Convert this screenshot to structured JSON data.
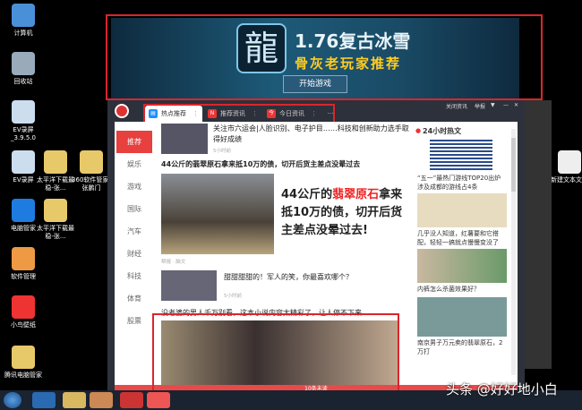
{
  "desktop": {
    "icons": [
      {
        "label": "计算机",
        "color": "#4a90d9"
      },
      {
        "label": "回收站",
        "color": "#9ab"
      },
      {
        "label": "EV录屏_3.9.5.0",
        "color": "#cde"
      },
      {
        "label": "EV录屏",
        "color": "#cde"
      },
      {
        "label": "太平洋下载最稳-张...",
        "color": "#e8c96a"
      },
      {
        "label": "360软件管家-张鹏门",
        "color": "#e8c96a"
      },
      {
        "label": "电脑管家",
        "color": "#1e7be0"
      },
      {
        "label": "太平洋下载最稳-张...",
        "color": "#e8c96a"
      },
      {
        "label": "软件管理",
        "color": "#e94"
      },
      {
        "label": "小鸟壁纸",
        "color": "#e33"
      },
      {
        "label": "腾讯电脑管家",
        "color": "#e8c96a"
      },
      {
        "label": "新建文本文档",
        "color": "#eee"
      }
    ]
  },
  "banner": {
    "logo": "龍",
    "title": "1.76复古冰雪",
    "subtitle": "骨灰老玩家推荐",
    "button": "开始游戏"
  },
  "window": {
    "tabs": [
      {
        "label": "热点推荐",
        "icon": "news-icon",
        "color": "#1e90ff"
      },
      {
        "label": "推荐资讯",
        "icon": "n-icon",
        "color": "#e33"
      },
      {
        "label": "今日资讯",
        "icon": "today-icon",
        "color": "#e33"
      }
    ],
    "controls": {
      "close_news": "关闭资讯",
      "report": "举报"
    },
    "nav": [
      "推荐",
      "娱乐",
      "游戏",
      "国际",
      "汽车",
      "财经",
      "科技",
      "体育",
      "股票"
    ],
    "articles": [
      {
        "title": "关注市六运会|人脸识别、电子护目……科技和创新助力选手取得好成绩",
        "meta": "5小时前"
      },
      {
        "title": "44公斤的翡翠原石拿来抵10万的债，切开后货主差点没晕过去",
        "overlay_pre": "44公斤的",
        "overlay_red": "翡翠原石",
        "overlay_post": "拿来抵10万的债，切开后货主差点没晕过去!",
        "meta": "帮报 · 脑文"
      },
      {
        "title": "甜甜甜甜的！军人的笑，你最喜欢哪个？",
        "meta": "5小时前"
      },
      {
        "title": "没老婆的男人千万别看，这本小说内容太精彩了，让人停不下来"
      }
    ],
    "side": {
      "title": "24小时热文",
      "items": [
        "“五一”最热门游线TOP20出炉 涉及成都的游线占4条",
        "几乎没人知道，红薯要和它搭配，轻轻一搞就点慢慢变没了",
        "内裤怎么杀菌效果好？",
        "南京男子万元卖的翡翠原石，2万打"
      ]
    },
    "unread": "10条未读"
  },
  "watermark": "头条 @好好地小白"
}
